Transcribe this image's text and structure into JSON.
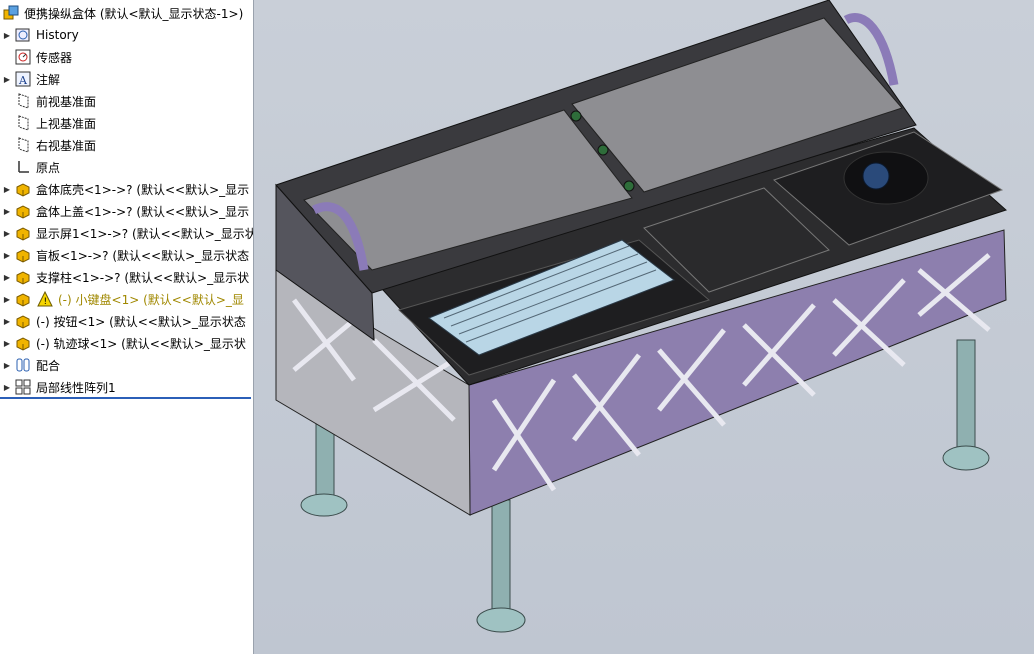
{
  "tree": {
    "root_label": "便携操纵盒体  (默认<默认_显示状态-1>)",
    "items": [
      {
        "label": "History",
        "icon": "history-icon",
        "expandable": true
      },
      {
        "label": "传感器",
        "icon": "sensor-icon",
        "expandable": false
      },
      {
        "label": "注解",
        "icon": "annotation-icon",
        "expandable": true
      },
      {
        "label": "前视基准面",
        "icon": "plane-icon",
        "expandable": false
      },
      {
        "label": "上视基准面",
        "icon": "plane-icon",
        "expandable": false
      },
      {
        "label": "右视基准面",
        "icon": "plane-icon",
        "expandable": false
      },
      {
        "label": "原点",
        "icon": "origin-icon",
        "expandable": false
      },
      {
        "label": "盒体底壳<1>->? (默认<<默认>_显示",
        "icon": "part-icon",
        "expandable": true
      },
      {
        "label": "盒体上盖<1>->? (默认<<默认>_显示",
        "icon": "part-icon",
        "expandable": true
      },
      {
        "label": "显示屏1<1>->? (默认<<默认>_显示状",
        "icon": "part-icon",
        "expandable": true
      },
      {
        "label": "盲板<1>->? (默认<<默认>_显示状态",
        "icon": "part-icon",
        "expandable": true
      },
      {
        "label": "支撑柱<1>->? (默认<<默认>_显示状",
        "icon": "part-icon",
        "expandable": true
      },
      {
        "label": "(-) 小键盘<1> (默认<<默认>_显",
        "icon": "part-icon",
        "expandable": true,
        "warning": true
      },
      {
        "label": "(-) 按钮<1> (默认<<默认>_显示状态",
        "icon": "part-icon",
        "expandable": true
      },
      {
        "label": "(-) 轨迹球<1> (默认<<默认>_显示状",
        "icon": "part-icon",
        "expandable": true
      },
      {
        "label": "配合",
        "icon": "mates-icon",
        "expandable": true
      },
      {
        "label": "局部线性阵列1",
        "icon": "pattern-icon",
        "expandable": true
      }
    ]
  },
  "colors": {
    "selection": "#2b5fb8",
    "part_icon": "#f0b400",
    "panel_purple": "#8d7fae",
    "legs": "#8fb0b0"
  }
}
